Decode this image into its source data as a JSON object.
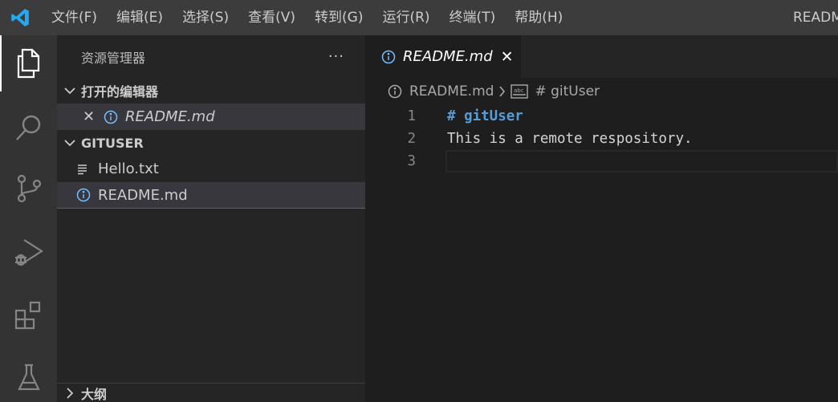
{
  "titlebar": {
    "logo_icon": "vscode-logo-icon",
    "menu": [
      "文件(F)",
      "编辑(E)",
      "选择(S)",
      "查看(V)",
      "转到(G)",
      "运行(R)",
      "终端(T)",
      "帮助(H)"
    ],
    "window_title": "README"
  },
  "activitybar": {
    "items": [
      "explorer-icon",
      "search-icon",
      "source-control-icon",
      "run-debug-icon",
      "extensions-icon",
      "testing-icon"
    ]
  },
  "sidebar": {
    "title": "资源管理器",
    "more": "···",
    "open_editors": {
      "header": "打开的编辑器",
      "items": [
        {
          "name": "README.md"
        }
      ]
    },
    "workspace": {
      "header": "GITUSER",
      "files": [
        {
          "name": "Hello.txt",
          "icon": "text-file-icon"
        },
        {
          "name": "README.md",
          "icon": "info-icon"
        }
      ]
    },
    "outline": {
      "header": "大纲"
    }
  },
  "editor": {
    "tab": {
      "label": "README.md",
      "close": "✕"
    },
    "breadcrumb": {
      "file": "README.md",
      "symbol": "# gitUser"
    },
    "lines": [
      {
        "num": "1",
        "text": "# gitUser"
      },
      {
        "num": "2",
        "text": "This is a remote respository."
      },
      {
        "num": "3",
        "text": ""
      }
    ]
  },
  "colors": {
    "titlebar": "#3c3c3c",
    "activitybar": "#333333",
    "sidebar": "#252526",
    "editor": "#1e1e1e",
    "accent_blue": "#75beff",
    "heading_blue": "#569cd6"
  }
}
